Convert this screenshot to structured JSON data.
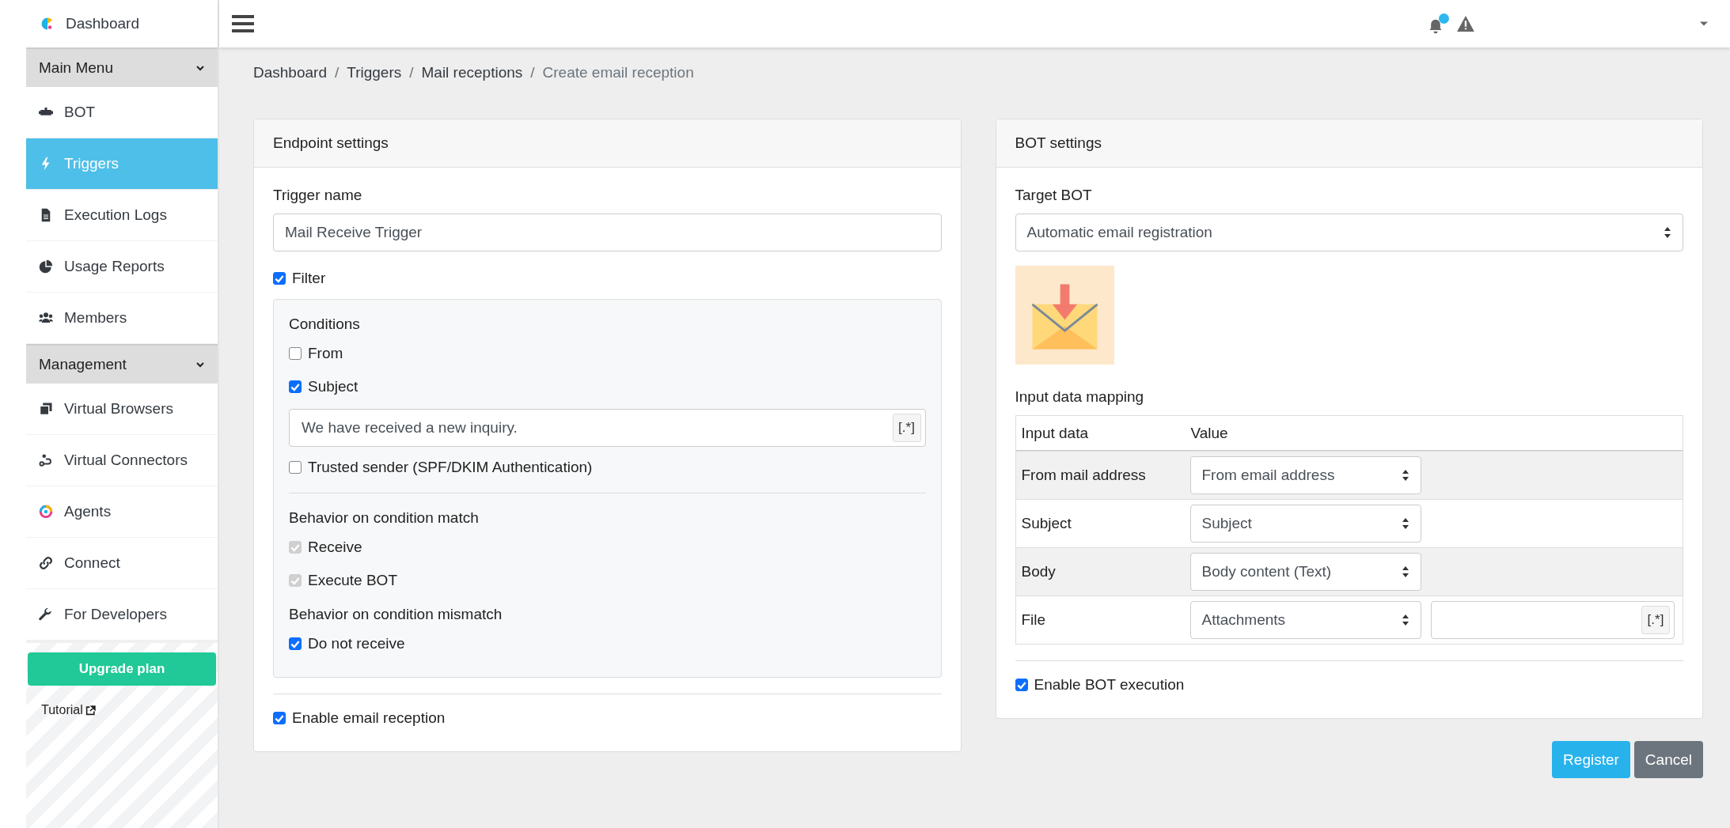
{
  "sidebar": {
    "brand": {
      "label": "Dashboard"
    },
    "items": [
      {
        "kind": "header",
        "label": "Main Menu",
        "expanded": true
      },
      {
        "kind": "link",
        "label": "BOT",
        "selected": false
      },
      {
        "kind": "link",
        "label": "Triggers",
        "selected": true
      },
      {
        "kind": "link",
        "label": "Execution Logs",
        "selected": false
      },
      {
        "kind": "link",
        "label": "Usage Reports",
        "selected": false
      },
      {
        "kind": "link",
        "label": "Members",
        "selected": false
      },
      {
        "kind": "header",
        "label": "Management",
        "expanded": true
      },
      {
        "kind": "link",
        "label": "Virtual Browsers",
        "selected": false
      },
      {
        "kind": "link",
        "label": "Virtual Connectors",
        "selected": false
      },
      {
        "kind": "link",
        "label": "Agents",
        "selected": false
      },
      {
        "kind": "link",
        "label": "Connect",
        "selected": false
      },
      {
        "kind": "link",
        "label": "For Developers",
        "selected": false
      }
    ],
    "upgrade_button": "Upgrade plan",
    "tutorial_link": "Tutorial"
  },
  "topbar": {
    "notifications_unread": true
  },
  "breadcrumb": {
    "separator": "/",
    "items": [
      {
        "label": "Dashboard",
        "current": false
      },
      {
        "label": "Triggers",
        "current": false
      },
      {
        "label": "Mail receptions",
        "current": false
      },
      {
        "label": "Create email reception",
        "current": true
      }
    ]
  },
  "endpoint": {
    "title": "Endpoint settings",
    "trigger_name": {
      "label": "Trigger name",
      "value": "Mail Receive Trigger"
    },
    "filter": {
      "label": "Filter",
      "checked": true
    },
    "conditions": {
      "title": "Conditions",
      "items": [
        {
          "kind": "checkbox",
          "label": "From",
          "checked": false
        },
        {
          "kind": "checkbox",
          "label": "Subject",
          "checked": true
        },
        {
          "kind": "pattern",
          "value": "We have received a new inquiry.",
          "button": "[.*]"
        },
        {
          "kind": "checkbox",
          "label": "Trusted sender (SPF/DKIM Authentication)",
          "checked": false
        }
      ]
    },
    "match": {
      "title": "Behavior on condition match",
      "options": [
        {
          "label": "Receive",
          "checked": true,
          "disabled": true
        },
        {
          "label": "Execute BOT",
          "checked": true,
          "disabled": true
        }
      ]
    },
    "mismatch": {
      "title": "Behavior on condition mismatch",
      "options": [
        {
          "label": "Do not receive",
          "checked": true,
          "disabled": false
        }
      ]
    },
    "enable": {
      "label": "Enable email reception",
      "checked": true
    }
  },
  "bot": {
    "title": "BOT settings",
    "target": {
      "label": "Target BOT",
      "value": "Automatic email registration"
    },
    "mapping": {
      "title": "Input data mapping",
      "columns": [
        "Input data",
        "Value"
      ],
      "rows": [
        {
          "label": "From mail address",
          "value": "From email address"
        },
        {
          "label": "Subject",
          "value": "Subject"
        },
        {
          "label": "Body",
          "value": "Body content (Text)"
        },
        {
          "label": "File",
          "value": "Attachments",
          "pattern_button": "[.*]"
        }
      ]
    },
    "enable": {
      "label": "Enable BOT execution",
      "checked": true
    }
  },
  "actions": [
    {
      "label": "Register",
      "kind": "primary"
    },
    {
      "label": "Cancel",
      "kind": "secondary"
    }
  ]
}
